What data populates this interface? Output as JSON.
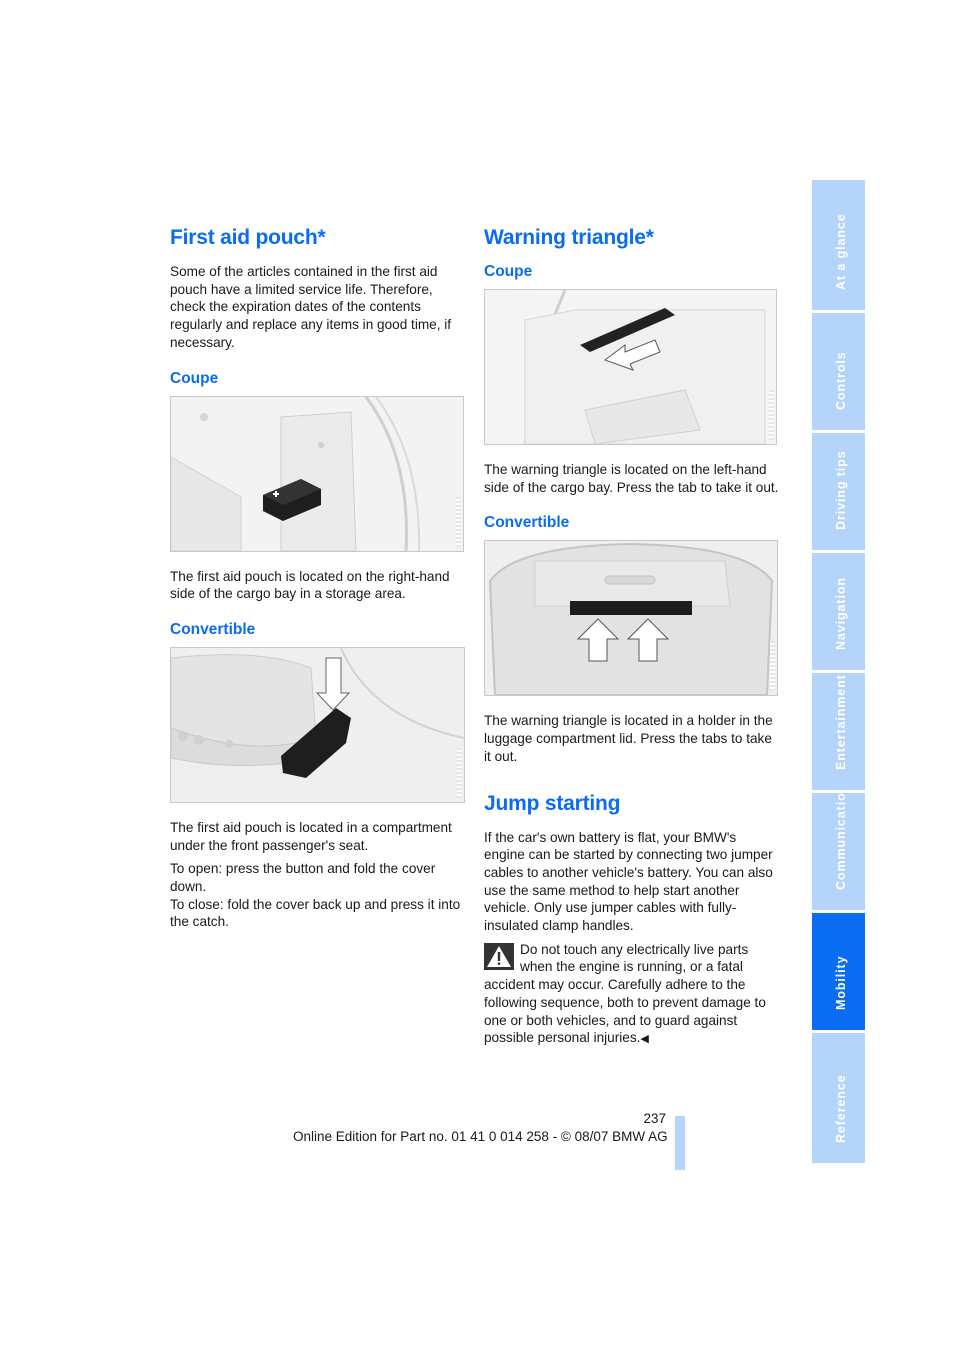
{
  "left": {
    "title": "First aid pouch*",
    "intro": "Some of the articles contained in the first aid pouch have a limited service life. Therefore, check the expiration dates of the contents regularly and replace any items in good time, if necessary.",
    "coupe": {
      "heading": "Coupe",
      "figure_desc": "first aid pouch in right-hand cargo bay storage area",
      "caption": "The first aid pouch is located on the right-hand side of the cargo bay in a storage area."
    },
    "convertible": {
      "heading": "Convertible",
      "figure_desc": "first aid pouch compartment under front passenger seat",
      "caption": "The first aid pouch is located in a compartment under the front passenger's seat.",
      "open": "To open: press the button and fold the cover down.",
      "close": "To close: fold the cover back up and press it into the catch."
    }
  },
  "right": {
    "title": "Warning triangle*",
    "coupe": {
      "heading": "Coupe",
      "figure_desc": "warning triangle on left-hand side of cargo bay",
      "caption": "The warning triangle is located on the left-hand side of the cargo bay. Press the tab to take it out."
    },
    "convertible": {
      "heading": "Convertible",
      "figure_desc": "warning triangle holder in luggage compartment lid",
      "caption": "The warning triangle is located in a holder in the luggage compartment lid. Press the tabs to take it out."
    },
    "jump": {
      "title": "Jump starting",
      "body": "If the car's own battery is flat, your BMW's engine can be started by connecting two jumper cables to another vehicle's battery. You can also use the same method to help start another vehicle. Only use jumper cables with fully-insulated clamp handles.",
      "warning": "Do not touch any electrically live parts when the engine is running, or a fatal accident may occur. Carefully adhere to the following sequence, both to prevent damage to one or both vehicles, and to guard against possible personal injuries.",
      "end_mark": "◀"
    }
  },
  "tabs": [
    {
      "label": "At a glance",
      "active": false
    },
    {
      "label": "Controls",
      "active": false
    },
    {
      "label": "Driving tips",
      "active": false
    },
    {
      "label": "Navigation",
      "active": false
    },
    {
      "label": "Entertainment",
      "active": false
    },
    {
      "label": "Communications",
      "active": false
    },
    {
      "label": "Mobility",
      "active": true
    },
    {
      "label": "Reference",
      "active": false
    }
  ],
  "footer": {
    "page_number": "237",
    "edition": "Online Edition for Part no. 01 41 0 014 258 - © 08/07 BMW AG"
  },
  "colors": {
    "accent": "#0a6cf0",
    "tab_inactive": "#b4d4fa"
  }
}
